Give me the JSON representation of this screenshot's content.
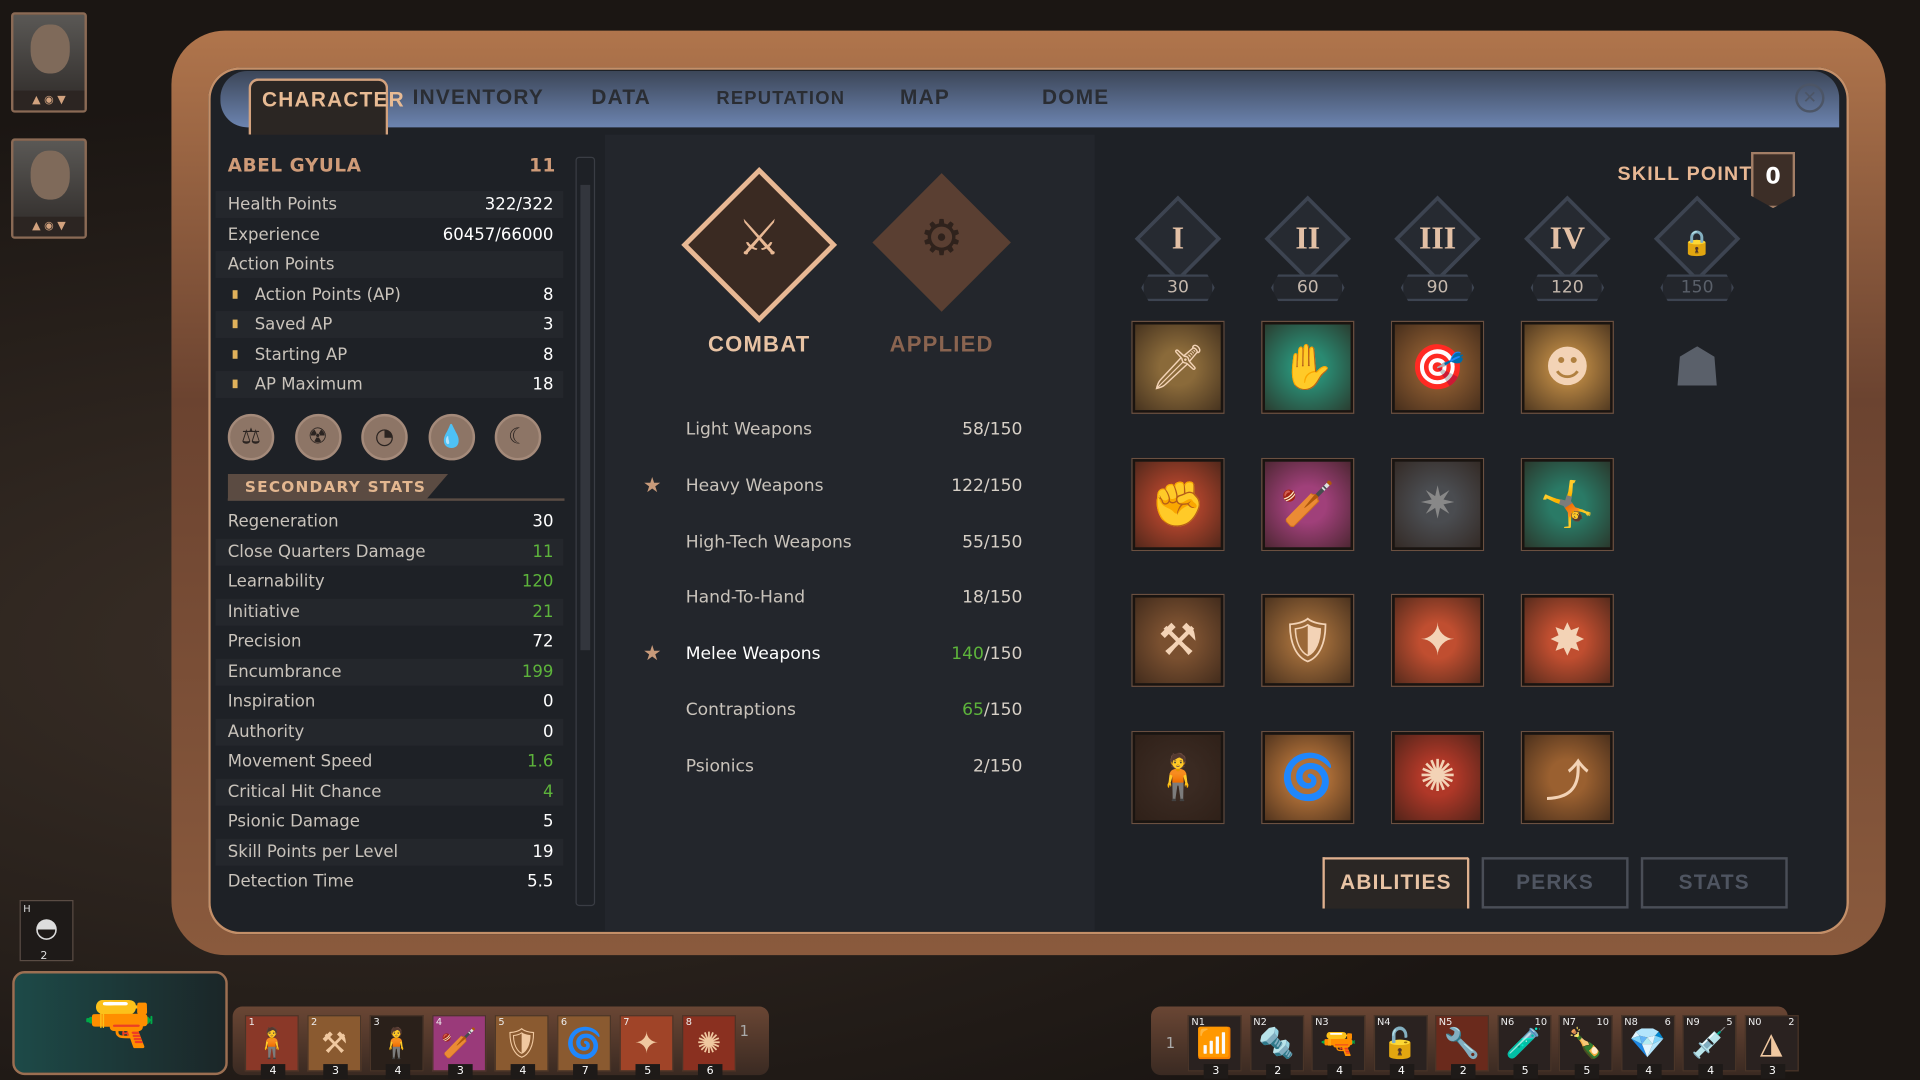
{
  "tabs": [
    {
      "label": "CHARACTER",
      "active": true
    },
    {
      "label": "INVENTORY"
    },
    {
      "label": "DATA"
    },
    {
      "label": "REPUTATION"
    },
    {
      "label": "MAP"
    },
    {
      "label": "DOME"
    }
  ],
  "close_icon": "close-icon",
  "character": {
    "name": "ABEL GYULA",
    "level": "11",
    "stats": [
      {
        "label": "Health Points",
        "value": "322/322"
      },
      {
        "label": "Experience",
        "value": "60457/66000"
      },
      {
        "label": "Action Points",
        "value": ""
      },
      {
        "label": "Action Points (AP)",
        "value": "8",
        "sub": true
      },
      {
        "label": "Saved AP",
        "value": "3",
        "sub": true
      },
      {
        "label": "Starting AP",
        "value": "8",
        "sub": true
      },
      {
        "label": "AP Maximum",
        "value": "18",
        "sub": true
      }
    ],
    "status_icons": [
      "weight-icon",
      "radiation-icon",
      "stomach-icon",
      "water-drop-icon",
      "sleep-icon"
    ],
    "secondary_header": "SECONDARY STATS",
    "secondary": [
      {
        "label": "Regeneration",
        "value": "30"
      },
      {
        "label": "Close Quarters Damage",
        "value": "11",
        "boosted": true
      },
      {
        "label": "Learnability",
        "value": "120",
        "boosted": true
      },
      {
        "label": "Initiative",
        "value": "21",
        "boosted": true
      },
      {
        "label": "Precision",
        "value": "72"
      },
      {
        "label": "Encumbrance",
        "value": "199",
        "boosted": true
      },
      {
        "label": "Inspiration",
        "value": "0"
      },
      {
        "label": "Authority",
        "value": "0"
      },
      {
        "label": "Movement Speed",
        "value": "1.6",
        "boosted": true
      },
      {
        "label": "Critical Hit Chance",
        "value": "4",
        "boosted": true
      },
      {
        "label": "Psionic Damage",
        "value": "5"
      },
      {
        "label": "Skill Points per Level",
        "value": "19"
      },
      {
        "label": "Detection Time",
        "value": "5.5"
      }
    ]
  },
  "categories": [
    {
      "label": "COMBAT",
      "active": true,
      "color": "#e8c3a4"
    },
    {
      "label": "APPLIED",
      "color": "#8a6450"
    }
  ],
  "skills": [
    {
      "label": "Light Weapons",
      "current": "58",
      "max": "/150"
    },
    {
      "label": "Heavy Weapons",
      "current": "122",
      "max": "/150",
      "starred": true
    },
    {
      "label": "High-Tech Weapons",
      "current": "55",
      "max": "/150"
    },
    {
      "label": "Hand-To-Hand",
      "current": "18",
      "max": "/150"
    },
    {
      "label": "Melee Weapons",
      "current": "140",
      "max": "/150",
      "starred": true,
      "selected": true,
      "boosted": true
    },
    {
      "label": "Contraptions",
      "current": "65",
      "max": "/150",
      "boosted": true
    },
    {
      "label": "Psionics",
      "current": "2",
      "max": "/150"
    }
  ],
  "skill_points": {
    "label": "SKILL POINTS",
    "value": "0"
  },
  "tiers": [
    {
      "numeral": "I",
      "cost": "30"
    },
    {
      "numeral": "II",
      "cost": "60"
    },
    {
      "numeral": "III",
      "cost": "90"
    },
    {
      "numeral": "IV",
      "cost": "120"
    },
    {
      "numeral": "",
      "cost": "150",
      "locked": true
    }
  ],
  "perks": [
    [
      {
        "icon": "spinning-strike-icon",
        "color": "#8a6a3a"
      },
      {
        "icon": "blade-grab-icon",
        "color": "#2a8a72"
      },
      {
        "icon": "aimed-stab-icon",
        "color": "#8a5a30"
      },
      {
        "icon": "bald-brute-icon",
        "color": "#b08040"
      }
    ],
    [
      {
        "icon": "shove-icon",
        "color": "#b0442c"
      },
      {
        "icon": "club-raise-icon",
        "color": "#a0407a"
      },
      {
        "icon": "spiked-mace-icon",
        "color": "#4a4c50",
        "locked": true
      },
      {
        "icon": "leaping-strike-icon",
        "color": "#2a7a66"
      }
    ],
    [
      {
        "icon": "mace-stance-icon",
        "color": "#7a5030"
      },
      {
        "icon": "broken-shield-icon",
        "color": "#9a6838"
      },
      {
        "icon": "brawl-icon",
        "color": "#c04e30"
      },
      {
        "icon": "shatter-icon",
        "color": "#c04e30"
      }
    ],
    [
      {
        "icon": "hunched-figure-icon",
        "color": "#3a2a22"
      },
      {
        "icon": "whirlwind-icon",
        "color": "#b07038"
      },
      {
        "icon": "dazed-icon",
        "color": "#b03828"
      },
      {
        "icon": "lunge-icon",
        "color": "#9a6030"
      }
    ]
  ],
  "tier5_icon": "flexing-brute-icon",
  "bottom_tabs": [
    {
      "label": "ABILITIES",
      "active": true
    },
    {
      "label": "PERKS"
    },
    {
      "label": "STATS"
    }
  ],
  "party": [
    {
      "name": "portrait-1",
      "icon": "goggles-character-icon"
    },
    {
      "name": "portrait-2",
      "icon": "character-icon"
    }
  ],
  "stealth_item": {
    "key": "H",
    "count": "2",
    "icon": "mask-icon"
  },
  "weapon_icon": "heavy-weapon-icon",
  "hotbar_left": {
    "page": "1",
    "slots": [
      {
        "key": "1",
        "ap": "4",
        "color": "#8a3828"
      },
      {
        "key": "2",
        "ap": "3",
        "color": "#8a5a30"
      },
      {
        "key": "3",
        "ap": "4",
        "color": "#2a201a"
      },
      {
        "key": "4",
        "ap": "3",
        "color": "#9a3a7a"
      },
      {
        "key": "5",
        "ap": "4",
        "color": "#8a5a30"
      },
      {
        "key": "6",
        "ap": "7",
        "color": "#8a5a30"
      },
      {
        "key": "7",
        "ap": "5",
        "color": "#a04428"
      },
      {
        "key": "8",
        "ap": "6",
        "color": "#8a3020"
      }
    ]
  },
  "hotbar_right": {
    "page": "1",
    "slots": [
      {
        "key": "N1",
        "ap": "3",
        "icon": "signal-icon"
      },
      {
        "key": "N2",
        "ap": "2",
        "icon": "bolt-icon"
      },
      {
        "key": "N3",
        "ap": "4",
        "icon": "smg-icon"
      },
      {
        "key": "N4",
        "ap": "4",
        "icon": "unlock-icon"
      },
      {
        "key": "N5",
        "ap": "2",
        "icon": "wrench-icon"
      },
      {
        "key": "N6",
        "qty": "10",
        "ap": "5",
        "icon": "stim-icon"
      },
      {
        "key": "N7",
        "qty": "10",
        "ap": "5",
        "icon": "molotov-icon"
      },
      {
        "key": "N8",
        "qty": "6",
        "ap": "4",
        "icon": "crystal-bag-icon"
      },
      {
        "key": "N9",
        "qty": "5",
        "ap": "4",
        "icon": "injector-icon"
      },
      {
        "key": "N0",
        "qty": "2",
        "ap": "3",
        "icon": "trap-icon"
      }
    ]
  }
}
